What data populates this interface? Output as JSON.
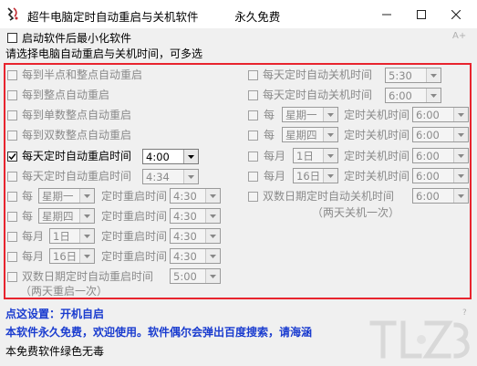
{
  "window": {
    "title": "超牛电脑定时自动重启与关机软件          永久免费",
    "controls": {
      "minimize": "—",
      "maximize": "☐",
      "close": "✕"
    }
  },
  "top": {
    "minimize_after_start": {
      "label": "启动软件后最小化软件",
      "checked": false
    },
    "instruction": "请选择电脑自动重启与关机时间，可多选",
    "font_ctrl": "A+"
  },
  "left_options": [
    {
      "label": "每到半点和整点自动重启",
      "checked": false,
      "enabled": false
    },
    {
      "label": "每到整点自动重启",
      "checked": false,
      "enabled": false
    },
    {
      "label": "每到单数整点自动重启",
      "checked": false,
      "enabled": false
    },
    {
      "label": "每到双数整点自动重启",
      "checked": false,
      "enabled": false
    },
    {
      "label": "每天定时自动重启时间",
      "checked": true,
      "enabled": true,
      "time": "4:00"
    },
    {
      "label": "每天定时自动重启时间",
      "checked": false,
      "enabled": false,
      "time": "4:34"
    },
    {
      "prefix": "每",
      "day": "星期一",
      "label": "定时重启时间",
      "checked": false,
      "enabled": false,
      "time": "4:30"
    },
    {
      "prefix": "每",
      "day": "星期四",
      "label": "定时重启时间",
      "checked": false,
      "enabled": false,
      "time": "4:30"
    },
    {
      "prefix": "每月",
      "day": "1日",
      "label": "定时重启时间",
      "checked": false,
      "enabled": false,
      "time": "4:30"
    },
    {
      "prefix": "每月",
      "day": "16日",
      "label": "定时重启时间",
      "checked": false,
      "enabled": false,
      "time": "4:30"
    },
    {
      "label": "双数日期定时自动重启时间",
      "checked": false,
      "enabled": false,
      "time": "5:00",
      "note": "（两天重启一次）"
    }
  ],
  "right_options": [
    {
      "label": "每天定时自动关机时间",
      "checked": false,
      "enabled": false,
      "time": "5:30"
    },
    {
      "label": "每天定时自动关机时间",
      "checked": false,
      "enabled": false,
      "time": "6:00"
    },
    {
      "prefix": "每",
      "day": "星期一",
      "label": "定时关机时间",
      "checked": false,
      "enabled": false,
      "time": "6:00"
    },
    {
      "prefix": "每",
      "day": "星期四",
      "label": "定时关机时间",
      "checked": false,
      "enabled": false,
      "time": "6:00"
    },
    {
      "prefix": "每月",
      "day": "1日",
      "label": "定时关机时间",
      "checked": false,
      "enabled": false,
      "time": "6:00"
    },
    {
      "prefix": "每月",
      "day": "16日",
      "label": "定时关机时间",
      "checked": false,
      "enabled": false,
      "time": "6:00"
    },
    {
      "label": "双数日期定时自动关机时间",
      "checked": false,
      "enabled": false,
      "time": "6:00",
      "note": "（两天关机一次）"
    }
  ],
  "footer": {
    "settings_line": "点这设置：开机自启",
    "notice_line": "本软件永久免费，欢迎使用。软件偶尔会弹出百度搜索，请海涵",
    "free_line": "本免费软件绿色无毒",
    "corner_mark": "?"
  },
  "colors": {
    "accent_red": "#e8242e",
    "footer_blue": "#1a3ccf"
  }
}
